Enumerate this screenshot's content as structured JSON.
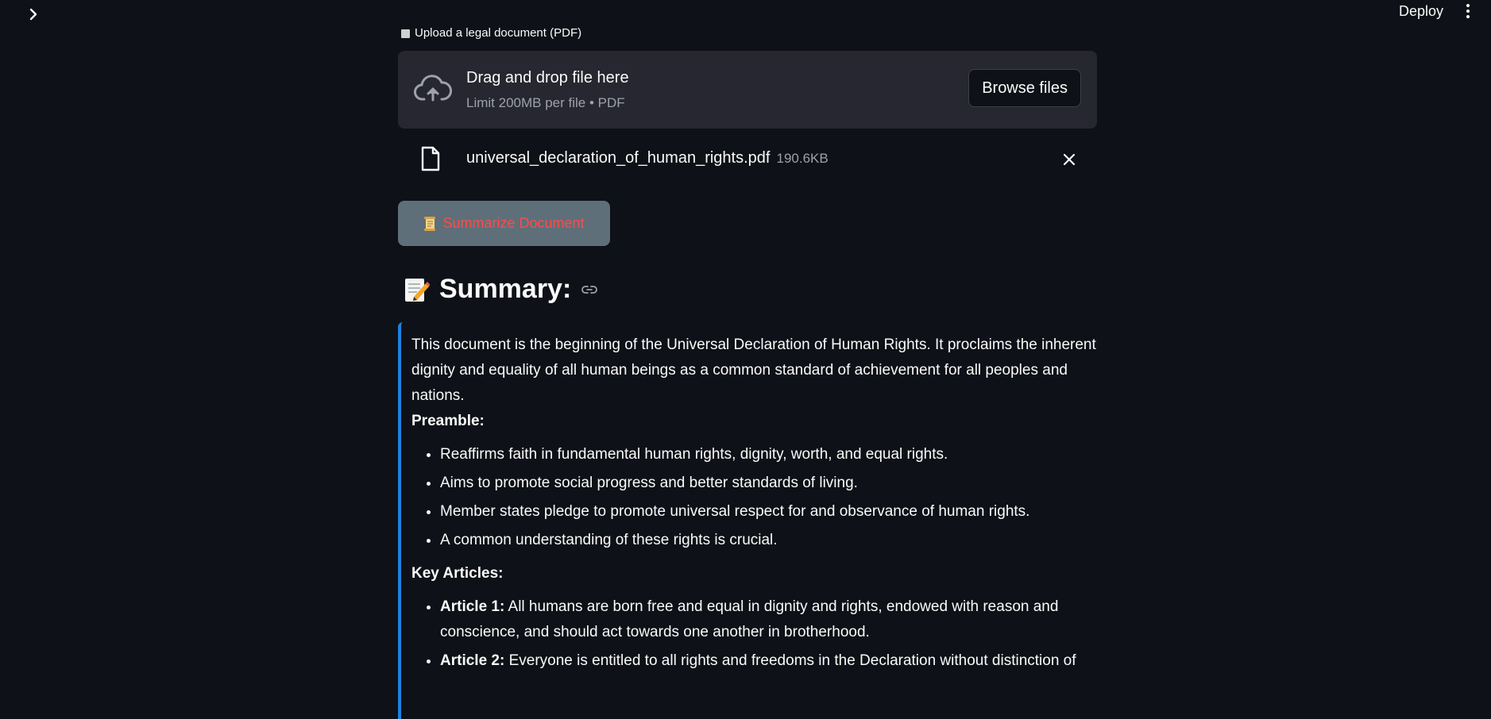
{
  "topbar": {
    "sidebar_toggle_icon": "chevron-right-icon",
    "deploy_label": "Deploy",
    "menu_icon": "kebab-menu-icon"
  },
  "uploader": {
    "label": "Upload a legal document (PDF)",
    "drop_title": "Drag and drop file here",
    "limit_text": "Limit 200MB per file • PDF",
    "browse_label": "Browse files",
    "icon": "cloud-upload-icon"
  },
  "uploaded_file": {
    "name": "universal_declaration_of_human_rights.pdf",
    "size": "190.6KB",
    "icon": "file-icon",
    "remove_icon": "close-icon"
  },
  "summarize_button": {
    "icon": "scroll-icon",
    "label": "Summarize Document"
  },
  "summary": {
    "icon": "memo-icon",
    "heading": "Summary:",
    "link_icon": "link-icon",
    "intro": "This document is the beginning of the Universal Declaration of Human Rights. It proclaims the inherent dignity and equality of all human beings as a common standard of achievement for all peoples and nations.",
    "preamble_heading": "Preamble:",
    "preamble_items": [
      "Reaffirms faith in fundamental human rights, dignity, worth, and equal rights.",
      "Aims to promote social progress and better standards of living.",
      "Member states pledge to promote universal respect for and observance of human rights.",
      "A common understanding of these rights is crucial."
    ],
    "articles_heading": "Key Articles:",
    "articles": [
      {
        "label": "Article 1:",
        "text": " All humans are born free and equal in dignity and rights, endowed with reason and conscience, and should act towards one another in brotherhood."
      },
      {
        "label": "Article 2:",
        "text": " Everyone is entitled to all rights and freedoms in the Declaration without distinction of"
      }
    ]
  },
  "colors": {
    "background": "#0e1117",
    "surface": "#262730",
    "accent_blue": "#1c83e1",
    "primary_red": "#ff4b4b",
    "button_gray": "#5e6f79"
  }
}
